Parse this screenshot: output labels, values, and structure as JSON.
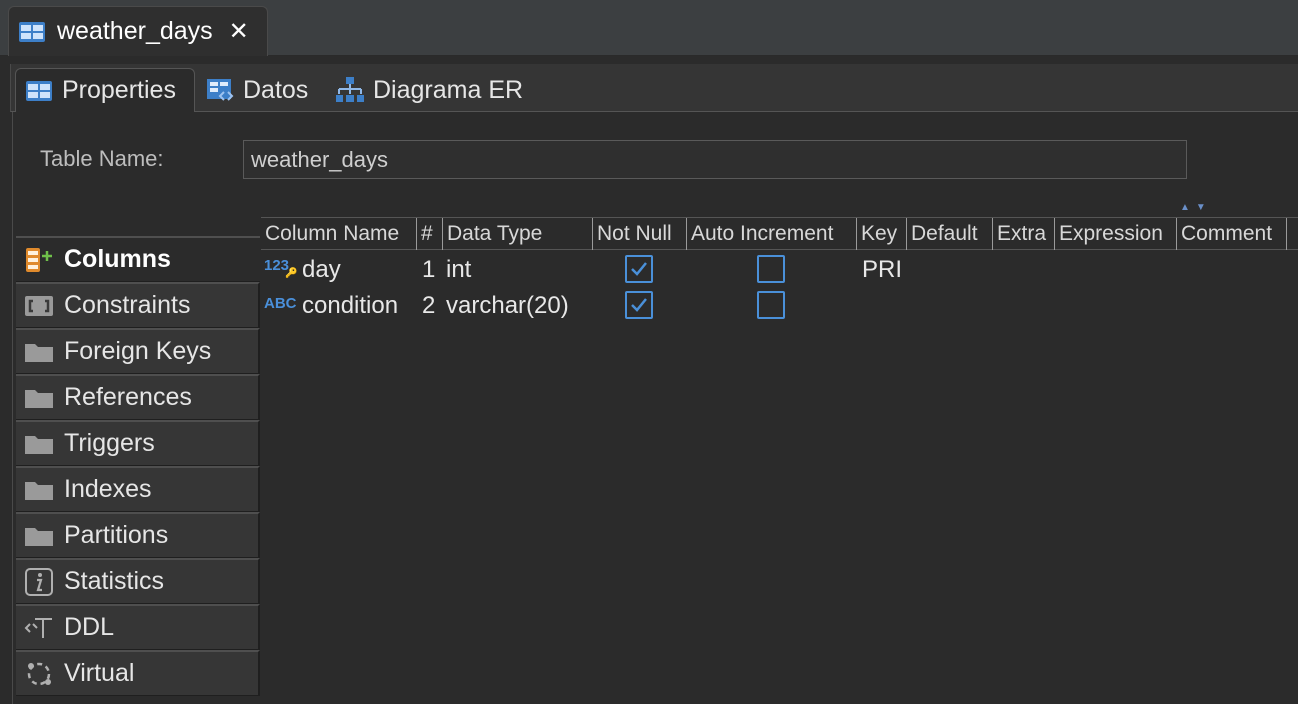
{
  "editor_tab": {
    "title": "weather_days"
  },
  "sub_tabs": [
    "Properties",
    "Datos",
    "Diagrama ER"
  ],
  "table_name": {
    "label": "Table Name:",
    "value": "weather_days"
  },
  "nav_items": [
    "Columns",
    "Constraints",
    "Foreign Keys",
    "References",
    "Triggers",
    "Indexes",
    "Partitions",
    "Statistics",
    "DDL",
    "Virtual"
  ],
  "columns_header": [
    "Column Name",
    "#",
    "Data Type",
    "Not Null",
    "Auto Increment",
    "Key",
    "Default",
    "Extra",
    "Expression",
    "Comment"
  ],
  "rows": [
    {
      "type_icon": "123",
      "name": "day",
      "num": "1",
      "data_type": "int",
      "not_null": true,
      "auto_increment": false,
      "key": "PRI"
    },
    {
      "type_icon": "ABC",
      "name": "condition",
      "num": "2",
      "data_type": "varchar(20)",
      "not_null": true,
      "auto_increment": false,
      "key": ""
    }
  ],
  "colors": {
    "accent": "#4a90d9",
    "background": "#2b2b2b"
  }
}
